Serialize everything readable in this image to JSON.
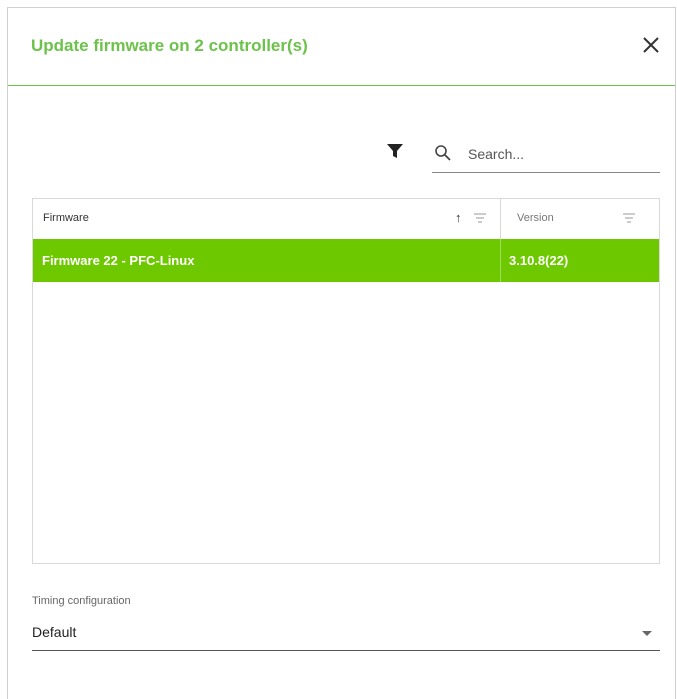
{
  "dialog": {
    "title": "Update firmware on 2 controller(s)",
    "close_icon": "close-icon",
    "accent_color": "#6cc24a",
    "selected_row_color": "#6ec800"
  },
  "toolbar": {
    "filter_icon": "filter-icon",
    "search_icon": "search-icon",
    "search_placeholder": "Search..."
  },
  "table": {
    "columns": [
      {
        "label": "Firmware",
        "sort": "ascending",
        "filter_icon": "filter-lines-icon"
      },
      {
        "label": "Version",
        "filter_icon": "filter-lines-icon"
      }
    ],
    "rows": [
      {
        "firmware": "Firmware 22 - PFC-Linux",
        "version": "3.10.8(22)",
        "selected": true
      }
    ]
  },
  "timing": {
    "label": "Timing configuration",
    "value": "Default"
  }
}
